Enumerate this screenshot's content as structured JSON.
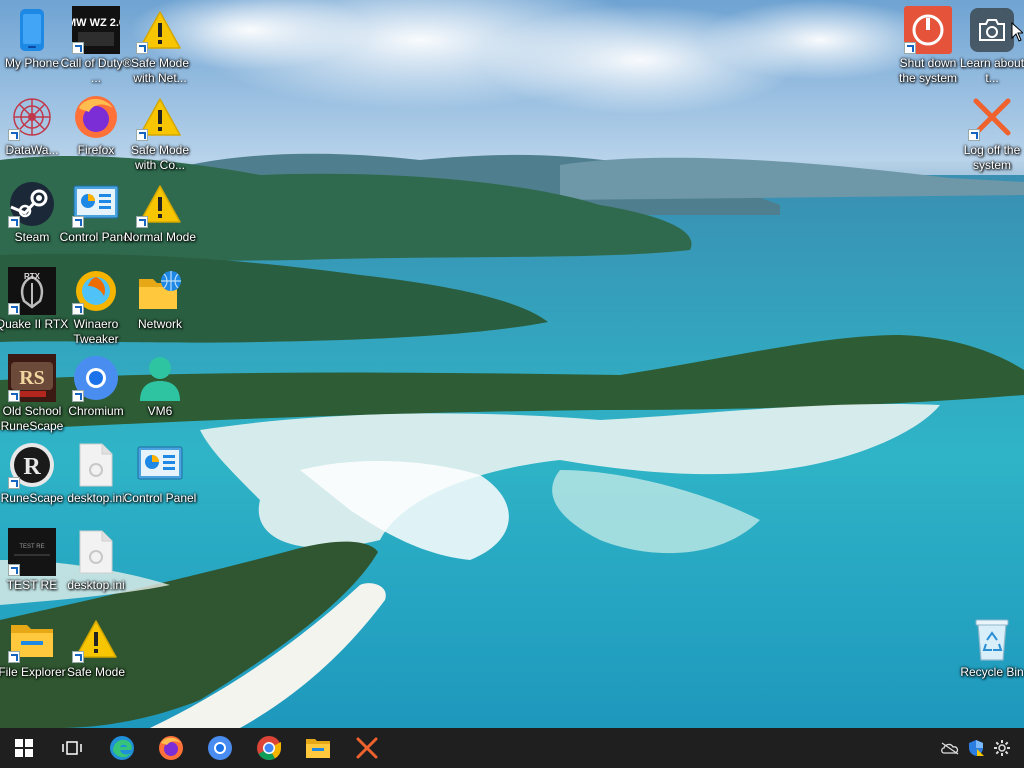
{
  "desktop": {
    "icons": [
      {
        "label": "My Phone",
        "icon": "phone-icon"
      },
      {
        "label": "Call of Duty® ...",
        "icon": "cod-icon"
      },
      {
        "label": "Safe Mode with Net...",
        "icon": "warning-icon"
      },
      {
        "label": "DataWa...",
        "icon": "datawa-icon"
      },
      {
        "label": "Firefox",
        "icon": "firefox-icon"
      },
      {
        "label": "Safe Mode with Co...",
        "icon": "warning-icon"
      },
      {
        "label": "Steam",
        "icon": "steam-icon"
      },
      {
        "label": "Control Panel",
        "icon": "control-panel-icon"
      },
      {
        "label": "Normal Mode",
        "icon": "warning-icon"
      },
      {
        "label": "Quake II RTX",
        "icon": "quake-icon"
      },
      {
        "label": "Winaero Tweaker",
        "icon": "winaero-icon"
      },
      {
        "label": "Network",
        "icon": "network-icon"
      },
      {
        "label": "Old School RuneScape",
        "icon": "osrs-icon"
      },
      {
        "label": "Chromium",
        "icon": "chromium-icon"
      },
      {
        "label": "VM6",
        "icon": "user-icon"
      },
      {
        "label": "RuneScape",
        "icon": "runescape-icon"
      },
      {
        "label": "desktop.ini",
        "icon": "file-icon"
      },
      {
        "label": "Control Panel",
        "icon": "control-panel-icon"
      },
      {
        "label": "TEST RE",
        "icon": "test-re-icon"
      },
      {
        "label": "desktop.ini",
        "icon": "file-icon"
      },
      {
        "label": "File Explorer",
        "icon": "folder-icon"
      },
      {
        "label": "Safe Mode",
        "icon": "warning-icon"
      },
      {
        "label": "Shut down the system",
        "icon": "power-icon"
      },
      {
        "label": "Learn about t...",
        "icon": "camera-icon"
      },
      {
        "label": "Log off the system",
        "icon": "close-x-icon"
      },
      {
        "label": "Recycle Bin",
        "icon": "recycle-bin-icon"
      }
    ],
    "logos": {
      "cod": "MW WZ 2.0",
      "osrs": "RS",
      "runescape": "R",
      "quake": "RTX",
      "test": "TEST RE"
    }
  },
  "taskbar": {
    "apps": [
      "start-icon",
      "task-view-icon",
      "edge-icon",
      "firefox-icon",
      "chromium-icon",
      "chrome-icon",
      "file-explorer-icon",
      "close-x-icon"
    ],
    "tray": [
      "onedrive-icon",
      "defender-icon",
      "settings-gear-icon"
    ]
  },
  "colors": {
    "taskbar": "#1f1f1f",
    "warning": "#f7c600",
    "accent": "#1565c0"
  }
}
